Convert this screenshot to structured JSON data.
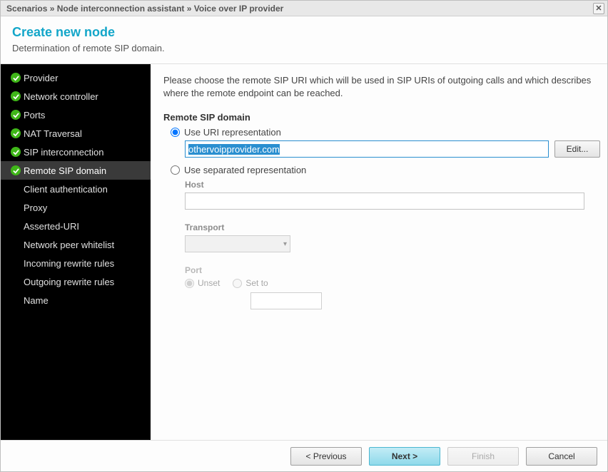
{
  "window": {
    "breadcrumb": "Scenarios » Node interconnection assistant » Voice over IP provider",
    "close_symbol": "✕"
  },
  "header": {
    "title": "Create new node",
    "subtitle": "Determination of remote SIP domain."
  },
  "sidebar": {
    "items": [
      {
        "label": "Provider",
        "done": true
      },
      {
        "label": "Network controller",
        "done": true
      },
      {
        "label": "Ports",
        "done": true
      },
      {
        "label": "NAT Traversal",
        "done": true
      },
      {
        "label": "SIP interconnection",
        "done": true
      },
      {
        "label": "Remote SIP domain",
        "done": true,
        "active": true
      },
      {
        "label": "Client authentication",
        "done": false
      },
      {
        "label": "Proxy",
        "done": false
      },
      {
        "label": "Asserted-URI",
        "done": false
      },
      {
        "label": "Network peer whitelist",
        "done": false
      },
      {
        "label": "Incoming rewrite rules",
        "done": false
      },
      {
        "label": "Outgoing rewrite rules",
        "done": false
      },
      {
        "label": "Name",
        "done": false
      }
    ]
  },
  "content": {
    "description": "Please choose the remote SIP URI which will be used in SIP URIs of outgoing calls and which describes where the remote endpoint can be reached.",
    "group_title": "Remote SIP domain",
    "radio_uri_label": "Use URI representation",
    "uri_value": "othervoipprovider.com",
    "edit_btn": "Edit...",
    "radio_sep_label": "Use separated representation",
    "host_label": "Host",
    "host_value": "",
    "transport_label": "Transport",
    "transport_value": "",
    "port_label": "Port",
    "port_unset_label": "Unset",
    "port_setto_label": "Set to",
    "port_value": ""
  },
  "footer": {
    "previous": "< Previous",
    "next": "Next >",
    "finish": "Finish",
    "cancel": "Cancel"
  }
}
